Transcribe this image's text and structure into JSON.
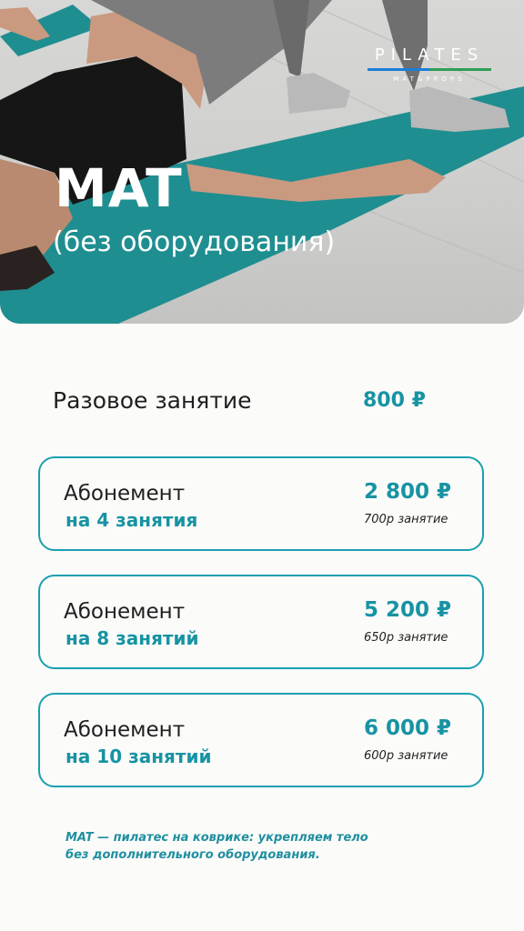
{
  "hero": {
    "title": "MAT",
    "subtitle": "(без оборудования)",
    "logo_main": "PILATES",
    "logo_sub": "MAT&PROPS"
  },
  "pricing": {
    "single": {
      "label": "Разовое занятие",
      "price": "800 ₽"
    },
    "cards": [
      {
        "title": "Абонемент",
        "subtitle": "на 4 занятия",
        "price": "2 800 ₽",
        "per": "700р занятие"
      },
      {
        "title": "Абонемент",
        "subtitle": "на 8 занятий",
        "price": "5 200 ₽",
        "per": "650р занятие"
      },
      {
        "title": "Абонемент",
        "subtitle": "на 10 занятий",
        "price": "6 000 ₽",
        "per": "600р занятие"
      }
    ]
  },
  "note": {
    "line1": "MAT — пилатес на коврике: укрепляем тело",
    "line2": "без дополнительного оборудования."
  },
  "colors": {
    "accent": "#1793a3",
    "border": "#1aa0b0",
    "mat": "#1f8e90",
    "background": "#fbfbf9"
  }
}
